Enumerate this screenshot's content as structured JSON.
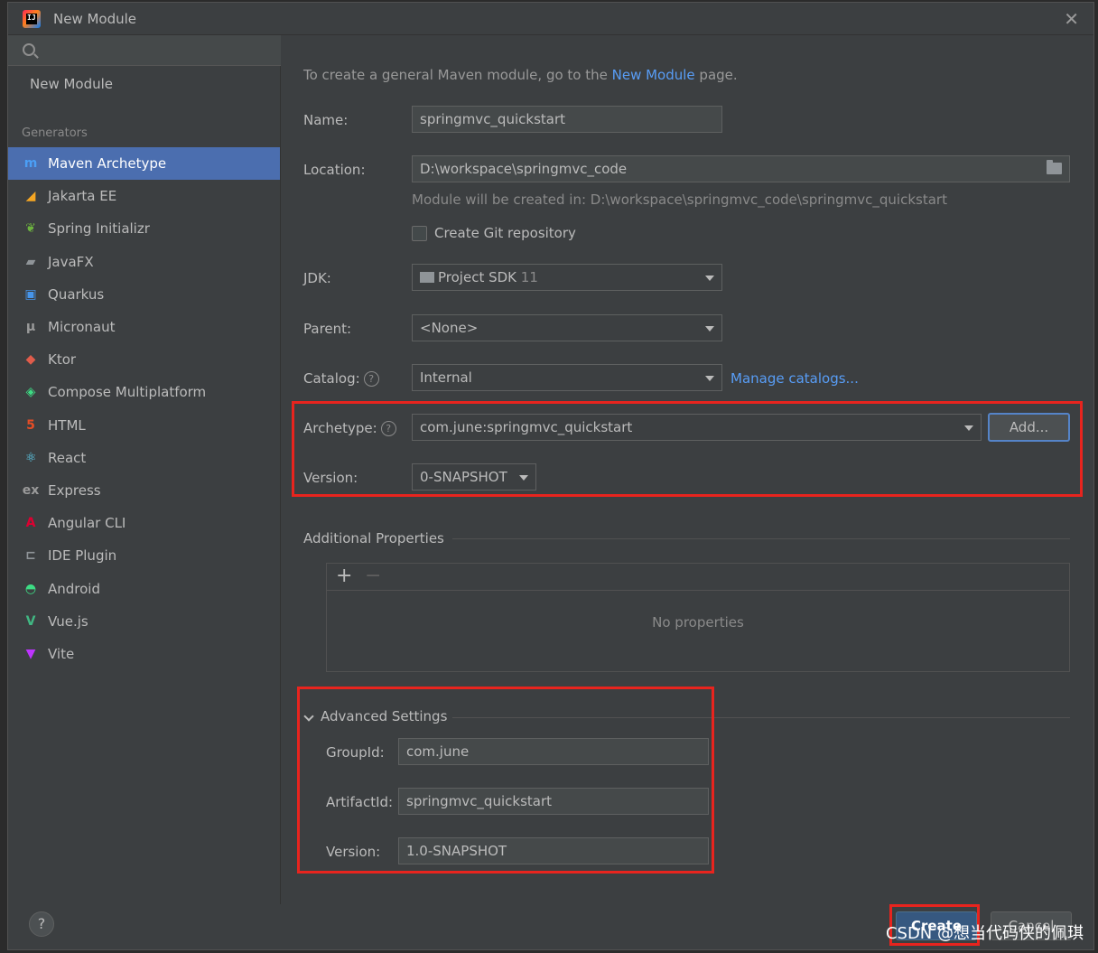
{
  "window": {
    "title": "New Module",
    "close_glyph": "✕"
  },
  "sidebar": {
    "search_placeholder": "",
    "new_module": "New Module",
    "generators_header": "Generators",
    "items": [
      {
        "label": "Maven Archetype",
        "icon": "maven-icon",
        "glyph": "m",
        "color": "#4b9ff5",
        "selected": true
      },
      {
        "label": "Jakarta EE",
        "icon": "jakarta-icon",
        "glyph": "◢",
        "color": "#f5a623"
      },
      {
        "label": "Spring Initializr",
        "icon": "spring-icon",
        "glyph": "❦",
        "color": "#6db33f"
      },
      {
        "label": "JavaFX",
        "icon": "javafx-folder-icon",
        "glyph": "▰",
        "color": "#8f9498"
      },
      {
        "label": "Quarkus",
        "icon": "quarkus-icon",
        "glyph": "▣",
        "color": "#4695eb"
      },
      {
        "label": "Micronaut",
        "icon": "micronaut-icon",
        "glyph": "μ",
        "color": "#9a9a9a"
      },
      {
        "label": "Ktor",
        "icon": "ktor-icon",
        "glyph": "◆",
        "color": "#e05c4b"
      },
      {
        "label": "Compose Multiplatform",
        "icon": "compose-icon",
        "glyph": "◈",
        "color": "#3ddc84"
      },
      {
        "label": "HTML",
        "icon": "html5-icon",
        "glyph": "5",
        "color": "#e44d26"
      },
      {
        "label": "React",
        "icon": "react-icon",
        "glyph": "⚛",
        "color": "#61dafb"
      },
      {
        "label": "Express",
        "icon": "express-icon",
        "glyph": "ex",
        "color": "#9a9a9a"
      },
      {
        "label": "Angular CLI",
        "icon": "angular-icon",
        "glyph": "A",
        "color": "#dd0031"
      },
      {
        "label": "IDE Plugin",
        "icon": "plugin-icon",
        "glyph": "⊏",
        "color": "#8f9498"
      },
      {
        "label": "Android",
        "icon": "android-icon",
        "glyph": "◓",
        "color": "#3ddc84"
      },
      {
        "label": "Vue.js",
        "icon": "vue-icon",
        "glyph": "V",
        "color": "#41b883"
      },
      {
        "label": "Vite",
        "icon": "vite-icon",
        "glyph": "▼",
        "color": "#bd34fe"
      }
    ],
    "help_glyph": "?"
  },
  "main": {
    "info_prefix": "To create a general Maven module, go to the ",
    "info_link": "New Module",
    "info_suffix": " page.",
    "name_label": "Name:",
    "name_value": "springmvc_quickstart",
    "location_label": "Location:",
    "location_value": "D:\\workspace\\springmvc_code",
    "location_hint": "Module will be created in: D:\\workspace\\springmvc_code\\springmvc_quickstart",
    "git_label": "Create Git repository",
    "jdk_label": "JDK:",
    "jdk_value": "Project SDK",
    "jdk_version": "11",
    "parent_label": "Parent:",
    "parent_value": "<None>",
    "catalog_label": "Catalog:",
    "catalog_value": "Internal",
    "manage_catalogs": "Manage catalogs...",
    "archetype_label": "Archetype:",
    "archetype_value": "com.june:springmvc_quickstart",
    "add_button": "Add...",
    "version_label": "Version:",
    "version_value": "0-SNAPSHOT",
    "additional_properties": "Additional Properties",
    "add_glyph": "+",
    "remove_glyph": "−",
    "no_properties": "No properties",
    "advanced_settings": "Advanced Settings",
    "groupid_label": "GroupId:",
    "groupid_value": "com.june",
    "artifactid_label": "ArtifactId:",
    "artifactid_value": "springmvc_quickstart",
    "adv_version_label": "Version:",
    "adv_version_value": "1.0-SNAPSHOT",
    "help_glyph": "?"
  },
  "footer": {
    "create_button": "Create",
    "cancel_button": "Cancel"
  },
  "watermark": "CSDN @想当代码侠的佩琪",
  "colors": {
    "accent": "#4b6eaf",
    "link": "#589df6",
    "highlight": "#e8241e"
  }
}
